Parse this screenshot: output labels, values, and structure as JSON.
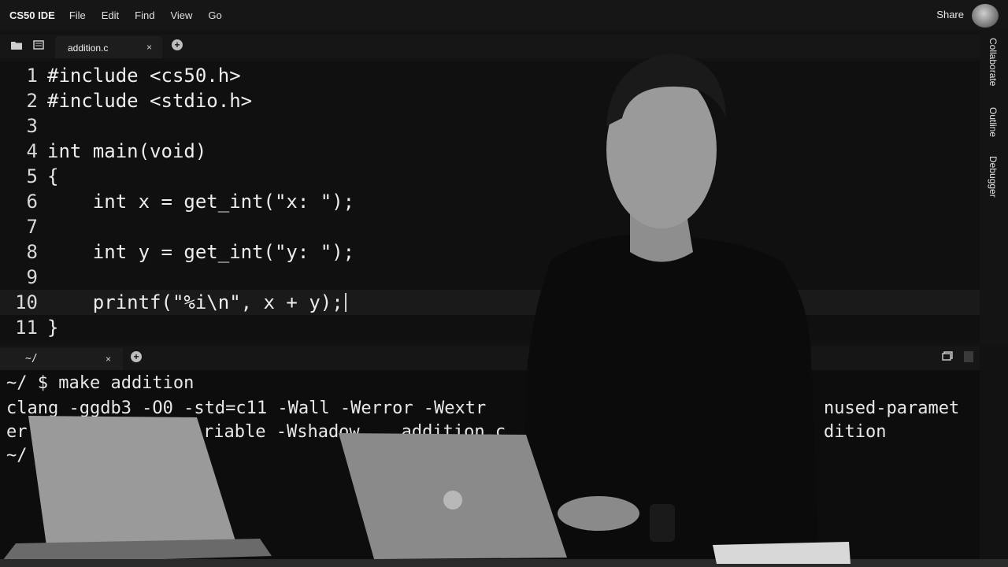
{
  "menubar": {
    "brand": "CS50 IDE",
    "items": [
      "File",
      "Edit",
      "Find",
      "View",
      "Go"
    ],
    "share": "Share"
  },
  "tabbar": {
    "tab_label": "addition.c",
    "close": "×",
    "add": "+"
  },
  "rightpanel": [
    "Collaborate",
    "Outline",
    "Debugger"
  ],
  "editor": {
    "lines": [
      {
        "n": "1",
        "code": "#include <cs50.h>"
      },
      {
        "n": "2",
        "code": "#include <stdio.h>"
      },
      {
        "n": "3",
        "code": ""
      },
      {
        "n": "4",
        "code": "int main(void)"
      },
      {
        "n": "5",
        "code": "{"
      },
      {
        "n": "6",
        "code": "    int x = get_int(\"x: \");"
      },
      {
        "n": "7",
        "code": ""
      },
      {
        "n": "8",
        "code": "    int y = get_int(\"y: \");"
      },
      {
        "n": "9",
        "code": ""
      },
      {
        "n": "10",
        "code": "    printf(\"%i\\n\", x + y);"
      },
      {
        "n": "11",
        "code": "}"
      }
    ],
    "active_line": 10
  },
  "terminal": {
    "tab_label": "~/",
    "close": "×",
    "add": "+",
    "lines": [
      "~/ $ make addition",
      "clang -ggdb3 -O0 -std=c11 -Wall -Werror -Wextr",
      "er",
      "~/"
    ],
    "fragments": {
      "line2_right": "nused-paramet",
      "line3_mid": "riable -Wshadow    addition.c",
      "line3_right": "dition"
    }
  },
  "colors": {
    "background": "#101010",
    "text": "#ededed",
    "menubar": "#161616"
  }
}
